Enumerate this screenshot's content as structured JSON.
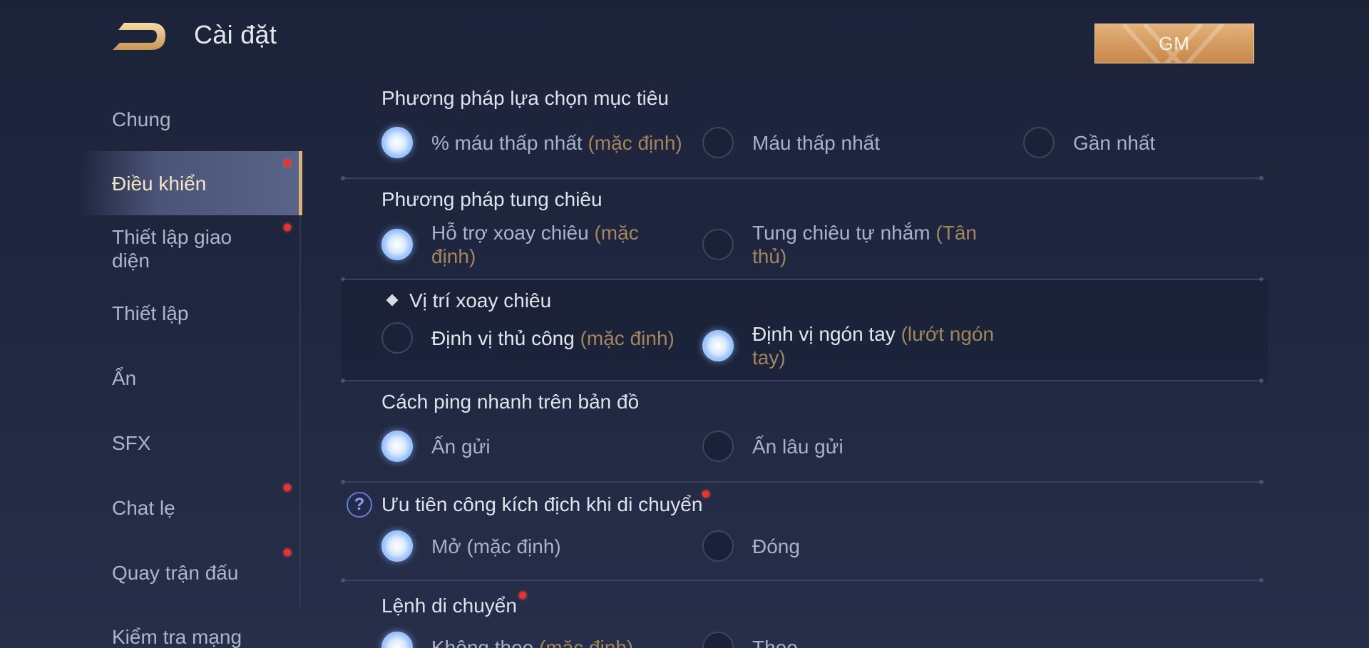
{
  "header": {
    "title": "Cài đặt",
    "gm_label": "GM"
  },
  "sidebar": {
    "items": [
      {
        "label": "Chung",
        "active": false,
        "badge": false
      },
      {
        "label": "Điều khiển",
        "active": true,
        "badge": true
      },
      {
        "label": "Thiết lập giao diện",
        "active": false,
        "badge": true
      },
      {
        "label": "Thiết lập",
        "active": false,
        "badge": false
      },
      {
        "label": "Ẩn",
        "active": false,
        "badge": false
      },
      {
        "label": "SFX",
        "active": false,
        "badge": false
      },
      {
        "label": "Chat lẹ",
        "active": false,
        "badge": true
      },
      {
        "label": "Quay trận đấu",
        "active": false,
        "badge": true
      },
      {
        "label": "Kiểm tra mạng",
        "active": false,
        "badge": false
      }
    ]
  },
  "settings": {
    "target": {
      "title": "Phương pháp lựa chọn mục tiêu",
      "opt1": "% máu thấp nhất",
      "opt1_def": "(mặc định)",
      "opt2": "Máu thấp nhất",
      "opt3": "Gần nhất",
      "selected": 1
    },
    "cast": {
      "title": "Phương pháp tung chiêu",
      "opt1": "Hỗ trợ xoay chiêu",
      "opt1_def": "(mặc",
      "opt1_line2": "định)",
      "opt2": "Tung chiêu tự nhắm",
      "opt2_def": "(Tân",
      "opt2_line2": "thủ)",
      "selected": 1
    },
    "rotate_pos": {
      "title": "Vị trí xoay chiêu",
      "opt1": "Định vị thủ công",
      "opt1_def": "(mặc định)",
      "opt2": "Định vị ngón tay",
      "opt2_def": "(lướt ngón",
      "opt2_line2": "tay)",
      "selected": 2
    },
    "ping": {
      "title": "Cách ping nhanh trên bản đồ",
      "opt1": "Ấn gửi",
      "opt2": "Ấn lâu gửi",
      "selected": 1
    },
    "attack_priority": {
      "title": "Ưu tiên công kích địch khi di chuyển",
      "help": "?",
      "opt1": "Mở (mặc định)",
      "opt2": "Đóng",
      "selected": 1
    },
    "move_cmd": {
      "title": "Lệnh di chuyển",
      "opt1": "Không theo",
      "opt1_def": "(mặc định)",
      "opt2": "Theo",
      "selected": 1
    }
  },
  "colors": {
    "accent_gold": "#d9b27b",
    "badge_red": "#e8342e",
    "radio_selected": "#9fc6ff",
    "default_hint": "#a3865e"
  }
}
